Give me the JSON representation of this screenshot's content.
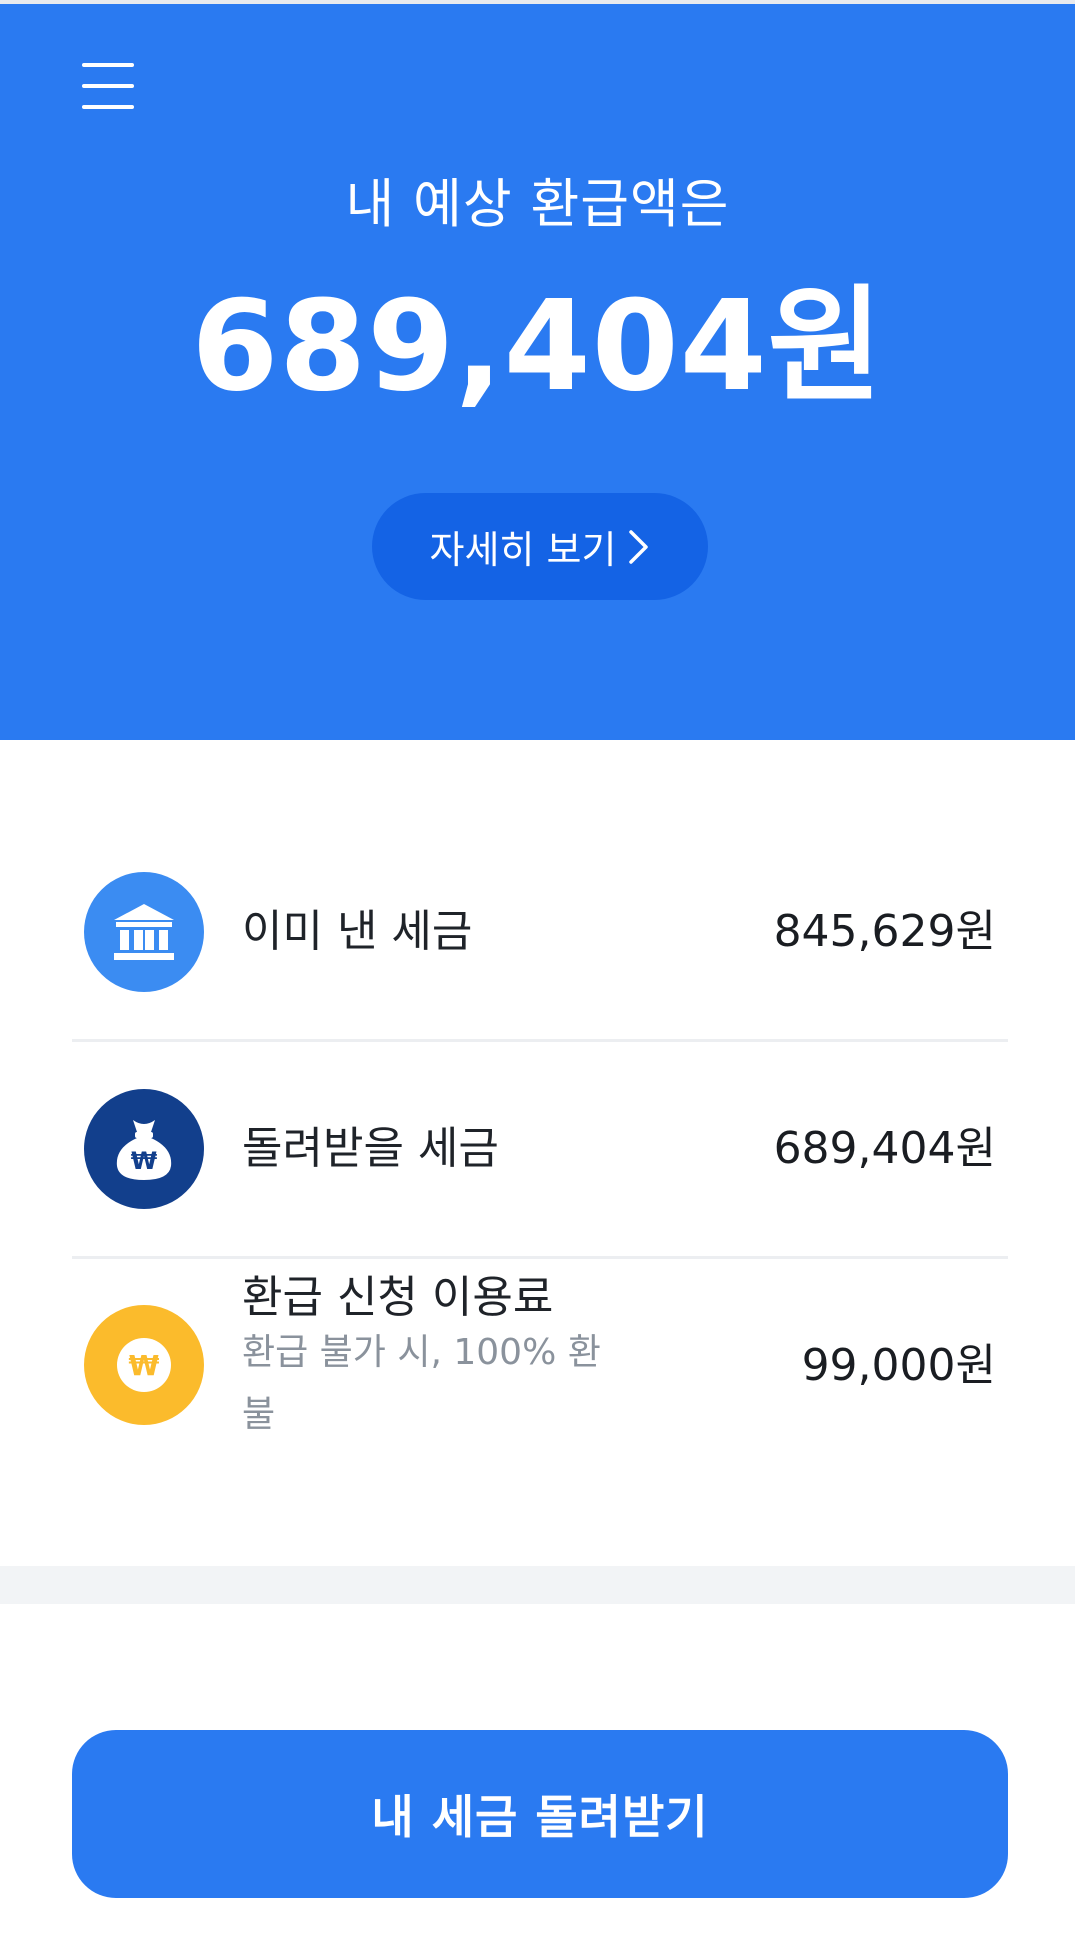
{
  "header": {
    "subtitle": "내 예상 환급액은",
    "amount": "689,404원",
    "detail_button": "자세히 보기",
    "bg_color": "#2a7af1"
  },
  "summary": {
    "items": [
      {
        "label": "이미 낸 세금",
        "value": "845,629원",
        "icon": "bank-icon",
        "color": "#3b8cf2"
      },
      {
        "label": "돌려받을 세금",
        "value": "689,404원",
        "icon": "money-bag-icon",
        "color": "#123f8c"
      },
      {
        "label": "환급 신청 이용료",
        "sub": "환급 불가 시, 100% 환불",
        "value": "99,000원",
        "icon": "won-coin-icon",
        "color": "#fbbb2c"
      }
    ]
  },
  "cta": {
    "label": "내 세금 돌려받기"
  }
}
